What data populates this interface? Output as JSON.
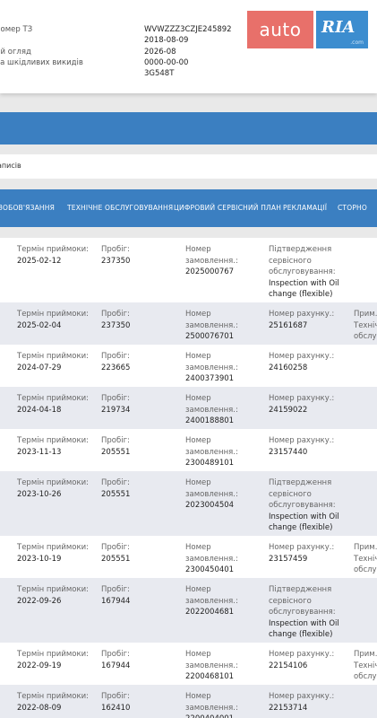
{
  "vehicle_info": {
    "rows": [
      {
        "label": "номер ТЗ",
        "value": "WVWZZZ3CZJE245892"
      },
      {
        "label": "",
        "value": "2018-08-09"
      },
      {
        "label": "ий огляд",
        "value": "2026-08"
      },
      {
        "label": "ка шкідливих викидів",
        "value": "0000-00-00"
      },
      {
        "label": "",
        "value": "3G548T"
      }
    ]
  },
  "logo": {
    "auto": "auto",
    "ria": "RIA",
    "com": ".com"
  },
  "records_count_text": "аписів",
  "tabs": [
    {
      "label": "ЗОБОВ'ЯЗАННЯ"
    },
    {
      "label": "ТЕХНІЧНЕ ОБСЛУГОВУВАННЯ"
    },
    {
      "label": "ЦИФРОВИЙ СЕРВІСНИЙ ПЛАН"
    },
    {
      "label": "РЕКЛАМАЦІЇ"
    },
    {
      "label": "СТОРНО"
    }
  ],
  "labels": {
    "date": "Термін приймоки:",
    "mileage": "Пробіг:",
    "order": "Номер замовлення.:",
    "invoice": "Номер рахунку.:",
    "confirm": "Підтвердження сервісного обслуговування:",
    "note": "Прим.:",
    "tech": "Технічн",
    "service": "обслуг"
  },
  "records": [
    {
      "date": "2025-02-12",
      "mileage": "237350",
      "order": "2025000767",
      "type": "confirm",
      "detail": "Inspection with Oil change (flexible)",
      "note": false
    },
    {
      "date": "2025-02-04",
      "mileage": "237350",
      "order": "2500076701",
      "type": "invoice",
      "detail": "25161687",
      "note": true
    },
    {
      "date": "2024-07-29",
      "mileage": "223665",
      "order": "2400373901",
      "type": "invoice",
      "detail": "24160258",
      "note": false
    },
    {
      "date": "2024-04-18",
      "mileage": "219734",
      "order": "2400188801",
      "type": "invoice",
      "detail": "24159022",
      "note": false
    },
    {
      "date": "2023-11-13",
      "mileage": "205551",
      "order": "2300489101",
      "type": "invoice",
      "detail": "23157440",
      "note": false
    },
    {
      "date": "2023-10-26",
      "mileage": "205551",
      "order": "2023004504",
      "type": "confirm",
      "detail": "Inspection with Oil change (flexible)",
      "note": false
    },
    {
      "date": "2023-10-19",
      "mileage": "205551",
      "order": "2300450401",
      "type": "invoice",
      "detail": "23157459",
      "note": true
    },
    {
      "date": "2022-09-26",
      "mileage": "167944",
      "order": "2022004681",
      "type": "confirm",
      "detail": "Inspection with Oil change (flexible)",
      "note": false
    },
    {
      "date": "2022-09-19",
      "mileage": "167944",
      "order": "2200468101",
      "type": "invoice",
      "detail": "22154106",
      "note": true
    },
    {
      "date": "2022-08-09",
      "mileage": "162410",
      "order": "2200404001",
      "type": "invoice",
      "detail": "22153714",
      "note": false
    }
  ]
}
